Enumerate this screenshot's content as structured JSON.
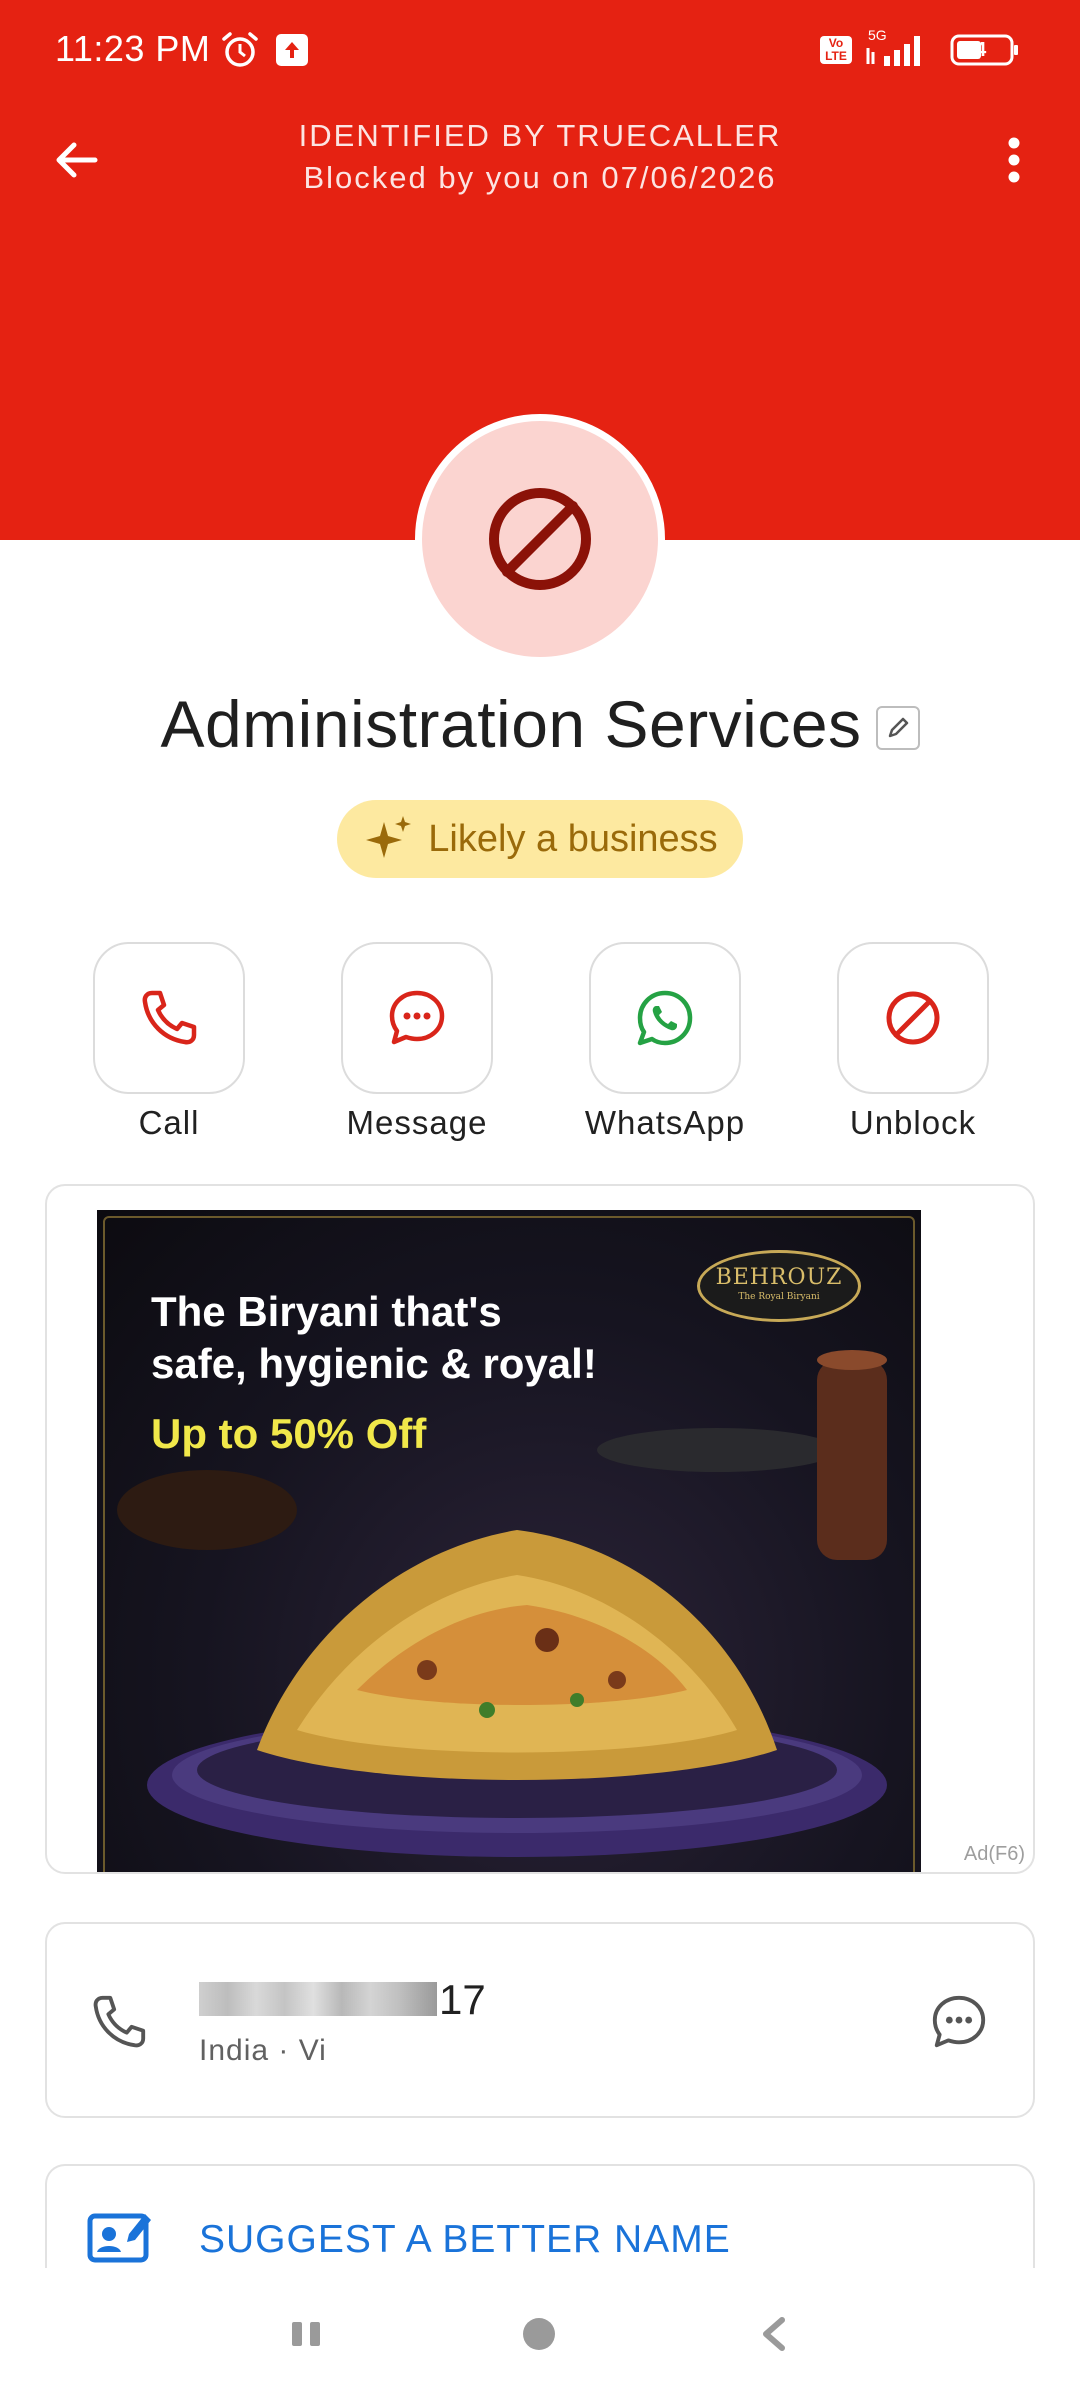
{
  "status_bar": {
    "time": "11:23 PM",
    "network": "5G",
    "volte": "Vo LTE",
    "battery": "44"
  },
  "header": {
    "title": "IDENTIFIED BY TRUECALLER",
    "subtitle": "Blocked by you on 07/06/2026",
    "color": "#e52212"
  },
  "contact": {
    "name": "Administration Services",
    "tag": "Likely a business"
  },
  "actions": [
    {
      "label": "Call",
      "icon": "phone-icon",
      "color": "#d9251a"
    },
    {
      "label": "Message",
      "icon": "message-icon",
      "color": "#d9251a"
    },
    {
      "label": "WhatsApp",
      "icon": "whatsapp-icon",
      "color": "#25a244"
    },
    {
      "label": "Unblock",
      "icon": "block-icon",
      "color": "#d9251a"
    }
  ],
  "ad": {
    "headline_line1": "The Biryani that's",
    "headline_line2": "safe, hygienic & royal!",
    "offer": "Up to 50% Off",
    "logo": "BEHROUZ",
    "logo_sub": "The Royal Biryani",
    "badge": "Ad(F6)"
  },
  "number": {
    "visible_suffix": "17",
    "details": "India · Vi"
  },
  "suggest": {
    "label": "SUGGEST A BETTER NAME"
  }
}
